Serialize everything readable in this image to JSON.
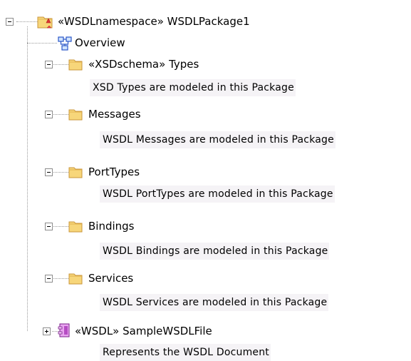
{
  "tree": {
    "root": {
      "label": "«WSDLnamespace» WSDLPackage1",
      "icon": "package-folder-icon"
    },
    "overview": {
      "label": "Overview",
      "icon": "diagram-icon"
    },
    "items": [
      {
        "label": "«XSDschema» Types",
        "note": "XSD Types are modeled in this Package",
        "icon": "folder-icon"
      },
      {
        "label": "Messages",
        "note": "WSDL Messages are modeled in this Package",
        "icon": "folder-icon"
      },
      {
        "label": "PortTypes",
        "note": "WSDL PortTypes are modeled in this Package",
        "icon": "folder-icon"
      },
      {
        "label": "Bindings",
        "note": "WSDL Bindings are modeled in this Package",
        "icon": "folder-icon"
      },
      {
        "label": "Services",
        "note": "WSDL Services are modeled in this Package",
        "icon": "folder-icon"
      }
    ],
    "wsdl_file": {
      "label": "«WSDL» SampleWSDLFile",
      "note": "Represents the WSDL Document",
      "icon": "wsdl-component-icon"
    }
  },
  "colors": {
    "folder_fill": "#f7d67a",
    "folder_stroke": "#c9963a",
    "note_background": "#f5f3f6",
    "connector": "#9a9a9a"
  }
}
